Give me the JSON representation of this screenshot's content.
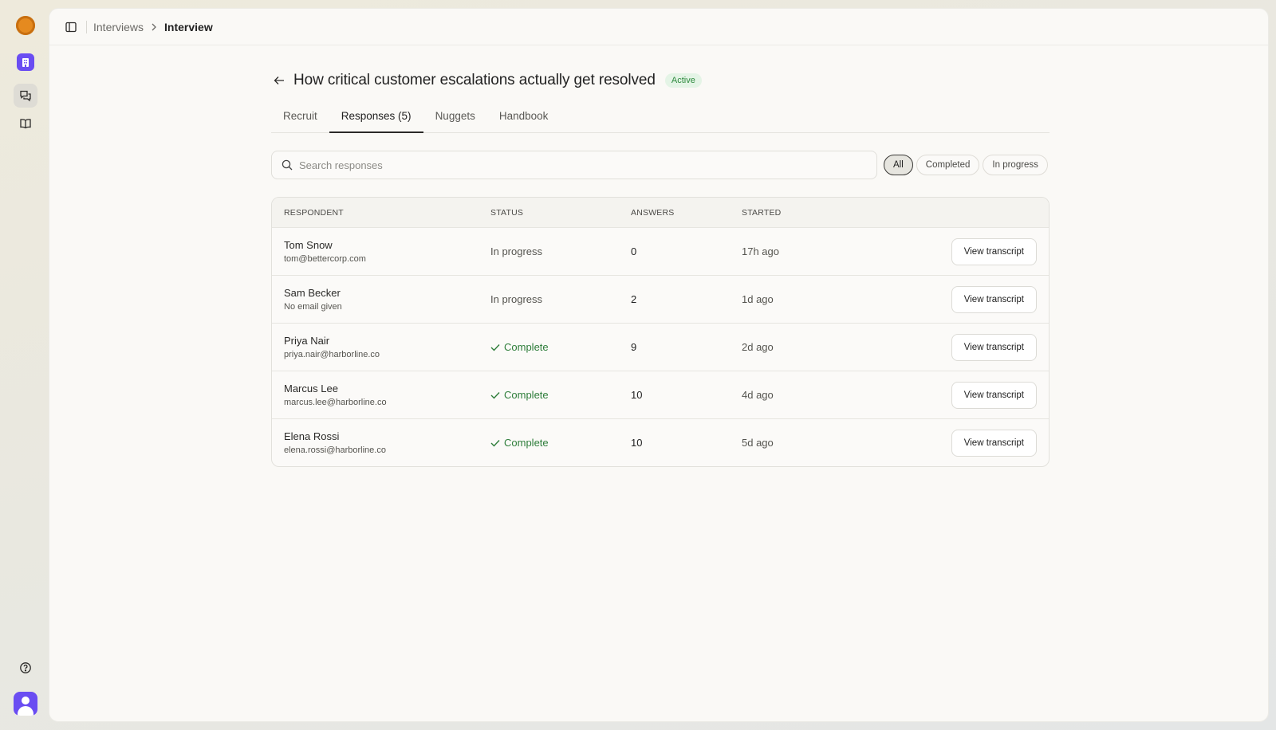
{
  "breadcrumb": {
    "parent": "Interviews",
    "current": "Interview"
  },
  "interview": {
    "title": "How critical customer escalations actually get resolved",
    "status_badge": "Active"
  },
  "tabs": [
    {
      "label": "Recruit"
    },
    {
      "label": "Responses (5)"
    },
    {
      "label": "Nuggets"
    },
    {
      "label": "Handbook"
    }
  ],
  "active_tab": "Responses (5)",
  "search": {
    "placeholder": "Search responses",
    "value": ""
  },
  "filters": [
    {
      "label": "All",
      "selected": true
    },
    {
      "label": "Completed",
      "selected": false
    },
    {
      "label": "In progress",
      "selected": false
    }
  ],
  "table": {
    "columns": [
      "RESPONDENT",
      "STATUS",
      "ANSWERS",
      "STARTED"
    ],
    "rows": [
      {
        "name": "Tom Snow",
        "email": "tom@bettercorp.com",
        "status": "In progress",
        "answers": "0",
        "started": "17h ago",
        "action": "View transcript"
      },
      {
        "name": "Sam Becker",
        "email": "No email given",
        "status": "In progress",
        "answers": "2",
        "started": "1d ago",
        "action": "View transcript"
      },
      {
        "name": "Priya Nair",
        "email": "priya.nair@harborline.co",
        "status": "Complete",
        "answers": "9",
        "started": "2d ago",
        "action": "View transcript"
      },
      {
        "name": "Marcus Lee",
        "email": "marcus.lee@harborline.co",
        "status": "Complete",
        "answers": "10",
        "started": "4d ago",
        "action": "View transcript"
      },
      {
        "name": "Elena Rossi",
        "email": "elena.rossi@harborline.co",
        "status": "Complete",
        "answers": "10",
        "started": "5d ago",
        "action": "View transcript"
      }
    ]
  },
  "rail_icons": [
    "logo-icon",
    "organization-icon",
    "conversations-icon",
    "handbook-icon",
    "help-icon",
    "user-avatar"
  ],
  "colors": {
    "accent": "#6a4df2",
    "brand_orange": "#e58a1f",
    "complete_green": "#2e7d3a",
    "active_badge_bg": "#e4f4e6"
  }
}
